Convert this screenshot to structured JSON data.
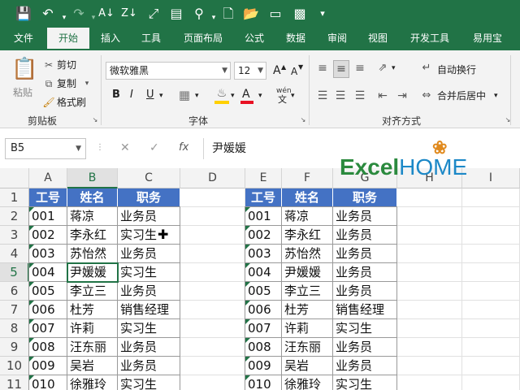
{
  "toolbar": {
    "icons": [
      "save-icon",
      "undo-icon",
      "redo-icon",
      "sort-ascending-icon",
      "sort-descending-icon",
      "freeze-panes-icon",
      "form-icon",
      "find-icon",
      "new-file-icon",
      "open-file-icon",
      "export-icon",
      "customize-icon"
    ]
  },
  "tabs": [
    "文件",
    "开始",
    "插入",
    "工具",
    "页面布局",
    "公式",
    "数据",
    "审阅",
    "视图",
    "开发工具",
    "易用宝"
  ],
  "active_tab": "开始",
  "ribbon": {
    "paste": "粘贴",
    "cut": "剪切",
    "copy": "复制",
    "format_painter": "格式刷",
    "clipboard_group": "剪贴板",
    "font_name": "微软雅黑",
    "font_size": "12",
    "grow_font": "A",
    "shrink_font": "A",
    "bold": "B",
    "italic": "I",
    "underline": "U",
    "wen": "wén",
    "font_color_letter": "A",
    "font_group": "字体",
    "wrap_text": "自动换行",
    "merge_center": "合并后居中",
    "align_group": "对齐方式",
    "colors": {
      "fill": "#ffd000",
      "font_red": "#e81123",
      "accent": "#217346"
    }
  },
  "formula_bar": {
    "name_box": "B5",
    "fx": "fx",
    "content": "尹媛媛"
  },
  "logo": {
    "part1": "Excel",
    "part2": "HOME"
  },
  "columns": [
    "A",
    "B",
    "C",
    "D",
    "E",
    "F",
    "G",
    "H",
    "I"
  ],
  "rows": [
    "1",
    "2",
    "3",
    "4",
    "5",
    "6",
    "7",
    "8",
    "9",
    "10",
    "11"
  ],
  "table_left": {
    "headers": [
      "工号",
      "姓名",
      "职务"
    ],
    "rows": [
      [
        "001",
        "蒋凉",
        "业务员"
      ],
      [
        "002",
        "李永红",
        "实习生"
      ],
      [
        "003",
        "苏怡然",
        "业务员"
      ],
      [
        "004",
        "尹媛媛",
        "实习生"
      ],
      [
        "005",
        "李立三",
        "业务员"
      ],
      [
        "006",
        "杜芳",
        "销售经理"
      ],
      [
        "007",
        "许莉",
        "实习生"
      ],
      [
        "008",
        "汪东丽",
        "业务员"
      ],
      [
        "009",
        "吴岩",
        "业务员"
      ],
      [
        "010",
        "徐雅玲",
        "实习生"
      ]
    ]
  },
  "table_right": {
    "headers": [
      "工号",
      "姓名",
      "职务"
    ],
    "rows": [
      [
        "001",
        "蒋凉",
        "业务员"
      ],
      [
        "002",
        "李永红",
        "业务员"
      ],
      [
        "003",
        "苏怡然",
        "业务员"
      ],
      [
        "004",
        "尹媛媛",
        "业务员"
      ],
      [
        "005",
        "李立三",
        "业务员"
      ],
      [
        "006",
        "杜芳",
        "销售经理"
      ],
      [
        "007",
        "许莉",
        "实习生"
      ],
      [
        "008",
        "汪东丽",
        "业务员"
      ],
      [
        "009",
        "吴岩",
        "业务员"
      ],
      [
        "010",
        "徐雅玲",
        "实习生"
      ]
    ]
  }
}
